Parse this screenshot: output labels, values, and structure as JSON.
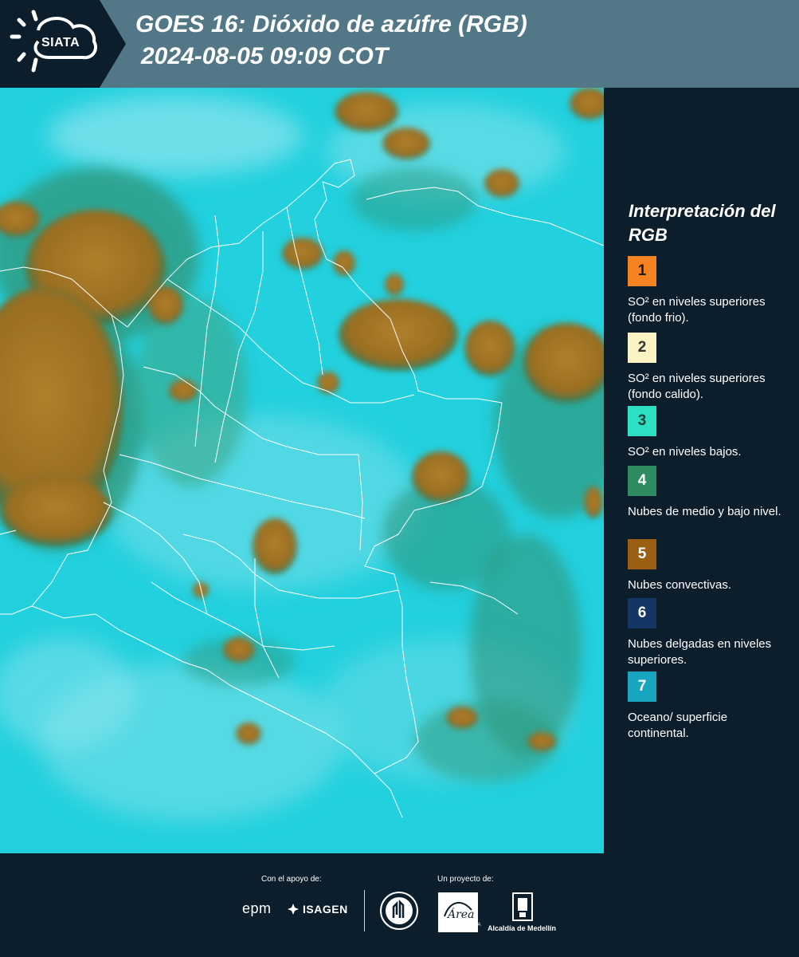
{
  "header": {
    "logo_text": "SIATA",
    "title_line1": "GOES 16: Dióxido de azúfre (RGB)",
    "title_line2": "2024-08-05 09:09 COT",
    "background": "#527786"
  },
  "legend": {
    "title": "Interpretación del RGB",
    "items": [
      {
        "number": "1",
        "label": "SO² en niveles superiores (fondo frio).",
        "color": "#f58220"
      },
      {
        "number": "2",
        "label": "SO² en niveles superiores (fondo calido).",
        "color": "#fbf3c4"
      },
      {
        "number": "3",
        "label": "SO² en niveles bajos.",
        "color": "#2de0c4"
      },
      {
        "number": "4",
        "label": "Nubes de medio y bajo nivel.",
        "color": "#2f8b60"
      },
      {
        "number": "5",
        "label": "Nubes convectivas.",
        "color": "#9a5f12"
      },
      {
        "number": "6",
        "label": "Nubes delgadas en niveles superiores.",
        "color": "#133664"
      },
      {
        "number": "7",
        "label": "Oceano/ superficie continental.",
        "color": "#17a5c0"
      }
    ]
  },
  "map": {
    "background_color": "#22d0de",
    "cloud_color": "#a87a2a",
    "green_cloud_color": "#2e9a80",
    "border_color": "#ffffff"
  },
  "footer": {
    "support_label": "Con el apoyo de:",
    "project_label": "Un proyecto de:",
    "sponsors": [
      "epm",
      "ISAGEN"
    ],
    "partners": {
      "area_line1": "METROPOLITANA",
      "area_line2": "Valle de Aburrá",
      "area_script": "Área",
      "alcaldia": "Alcaldía de Medellín"
    }
  }
}
